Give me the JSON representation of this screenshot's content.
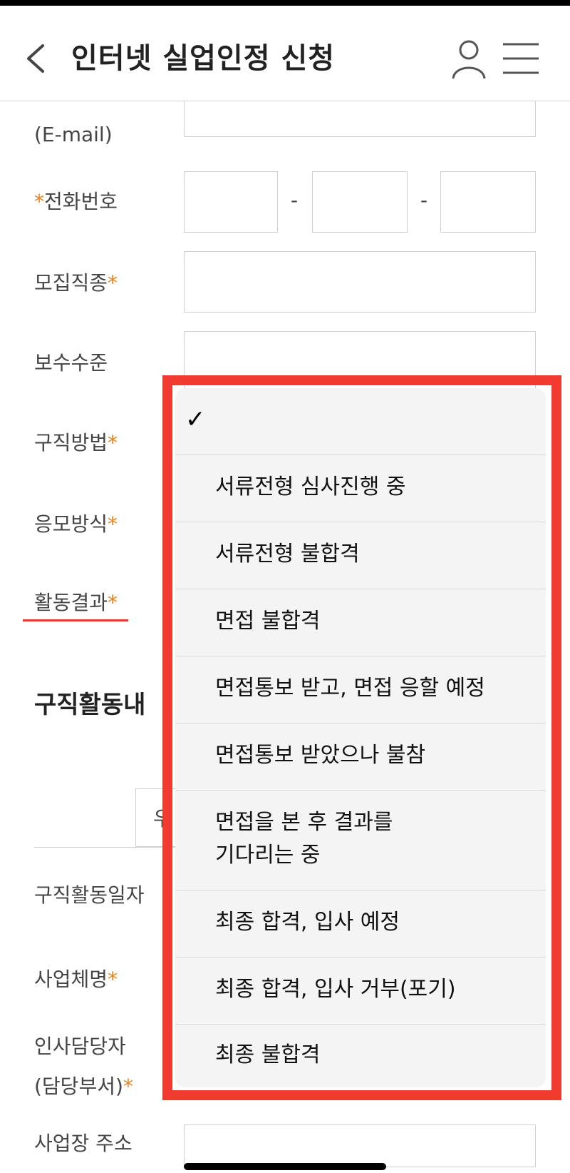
{
  "header": {
    "title": "인터넷 실업인정 신청",
    "back_icon": "chevron-left-icon",
    "user_icon": "user-icon",
    "menu_icon": "hamburger-menu-icon"
  },
  "form": {
    "email_label": "(E-mail)",
    "phone_label": "전화번호",
    "phone_sep": "-",
    "job_type_label": "모집직종",
    "salary_label": "보수수준",
    "method_label": "구직방법",
    "apply_label": "응모방식",
    "result_label": "활동결과",
    "required_mark": "*"
  },
  "section": {
    "title": "구직활동내",
    "segment_label": "우",
    "date_label": "구직활동일자",
    "company_label": "사업체명",
    "hr_label_1": "인사담당자",
    "hr_label_2": "(담당부서)",
    "address_label": "사업장 주소"
  },
  "dropdown": {
    "check": "✓",
    "options": [
      "서류전형 심사진행 중",
      "서류전형 불합격",
      "면접 불합격",
      "면접통보 받고, 면접 응할 예정",
      "면접통보 받았으나 불참",
      "면접을 본 후 결과를",
      "기다리는 중",
      "최종 합격, 입사 예정",
      "최종 합격, 입사 거부(포기)",
      "최종 불합격"
    ]
  },
  "colors": {
    "accent_star": "#e8821d",
    "highlight": "#f23b30",
    "underline": "#e53935"
  }
}
